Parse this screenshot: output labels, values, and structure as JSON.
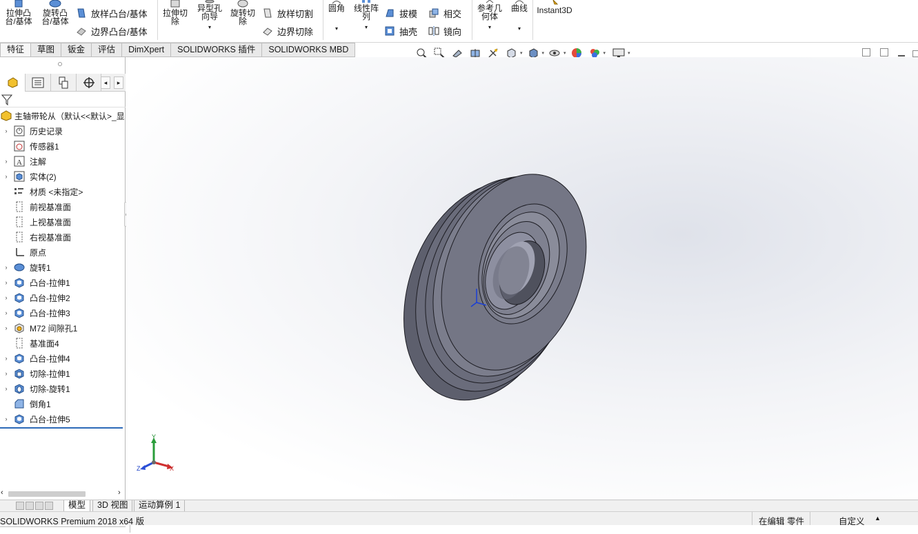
{
  "ribbon": {
    "extrude_boss": "拉伸凸\n台/基体",
    "revolve_boss": "旋转凸\n台/基体",
    "swept_boss": "放样凸台/基体",
    "boundary_boss": "边界凸台/基体",
    "extrude_cut": "拉伸切\n除",
    "hole_wizard": "异型孔\n向导",
    "revolve_cut": "旋转切\n除",
    "loft_cut": "放样切割",
    "boundary_cut": "边界切除",
    "fillet": "圆角",
    "linear_pattern": "线性阵\n列",
    "draft": "拔模",
    "shell": "抽壳",
    "intersect": "相交",
    "mirror": "镜向",
    "reference_geometry": "参考几\n何体",
    "curves": "曲线",
    "instant3d": "Instant3D"
  },
  "command_tabs": [
    "特征",
    "草图",
    "钣金",
    "评估",
    "DimXpert",
    "SOLIDWORKS 插件",
    "SOLIDWORKS MBD"
  ],
  "feature_tree": {
    "root": "主轴带轮从（默认<<默认>_显",
    "nodes": [
      {
        "label": "历史记录",
        "icon": "history-icon",
        "expand": true
      },
      {
        "label": "传感器1",
        "icon": "sensor-icon",
        "expand": false
      },
      {
        "label": "注解",
        "icon": "annotation-icon",
        "expand": true
      },
      {
        "label": "实体(2)",
        "icon": "solid-bodies-icon",
        "expand": true
      },
      {
        "label": "材质 <未指定>",
        "icon": "material-icon",
        "expand": false
      },
      {
        "label": "前视基准面",
        "icon": "plane-icon",
        "expand": false
      },
      {
        "label": "上视基准面",
        "icon": "plane-icon",
        "expand": false
      },
      {
        "label": "右视基准面",
        "icon": "plane-icon",
        "expand": false
      },
      {
        "label": "原点",
        "icon": "origin-icon",
        "expand": false
      },
      {
        "label": "旋转1",
        "icon": "revolve-icon",
        "expand": true
      },
      {
        "label": "凸台-拉伸1",
        "icon": "extrude-icon",
        "expand": true
      },
      {
        "label": "凸台-拉伸2",
        "icon": "extrude-icon",
        "expand": true
      },
      {
        "label": "凸台-拉伸3",
        "icon": "extrude-icon",
        "expand": true
      },
      {
        "label": "M72 间隙孔1",
        "icon": "hole-icon",
        "expand": true
      },
      {
        "label": "基准面4",
        "icon": "plane-icon",
        "expand": false
      },
      {
        "label": "凸台-拉伸4",
        "icon": "extrude-icon",
        "expand": true
      },
      {
        "label": "切除-拉伸1",
        "icon": "cut-extrude-icon",
        "expand": true
      },
      {
        "label": "切除-旋转1",
        "icon": "cut-revolve-icon",
        "expand": true
      },
      {
        "label": "倒角1",
        "icon": "chamfer-icon",
        "expand": false
      },
      {
        "label": "凸台-拉伸5",
        "icon": "extrude-icon",
        "expand": true
      }
    ]
  },
  "triad": {
    "x": "X",
    "y": "Y",
    "z": "Z"
  },
  "bottom_tabs": [
    "模型",
    "3D 视图",
    "运动算例 1"
  ],
  "status": {
    "app": "SOLIDWORKS Premium 2018 x64 版",
    "mode": "在编辑 零件",
    "units": "自定义",
    "units_arrow": "▲"
  },
  "colors": {
    "part_face": "#7b7d8c",
    "part_dark": "#5d5f6d",
    "accent_blue": "#2d6ab8"
  }
}
